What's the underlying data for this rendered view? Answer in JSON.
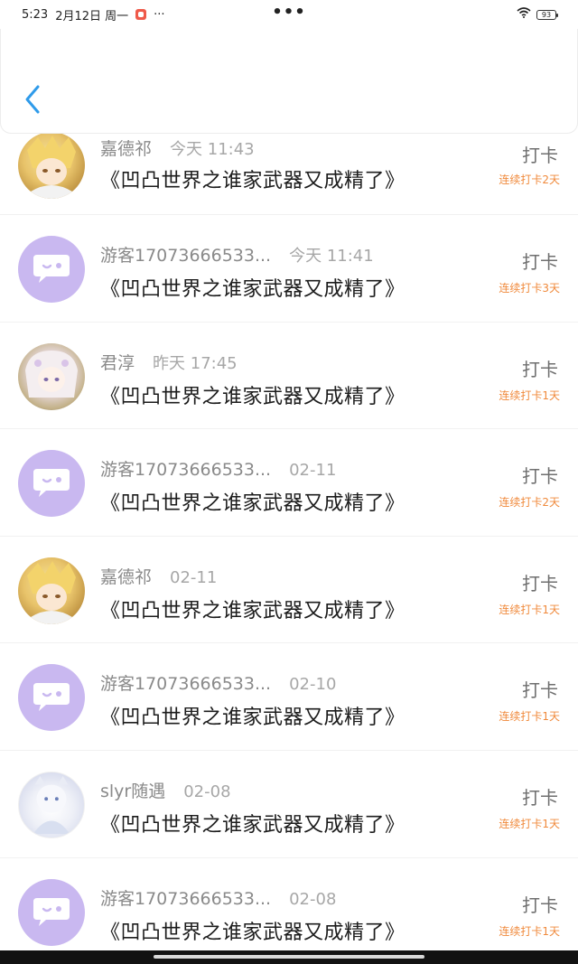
{
  "status_bar": {
    "time": "5:23",
    "date": "2月12日 周一",
    "more": "···",
    "center_dots": "•••",
    "battery": "93"
  },
  "header": {
    "back_icon": "chevron-left-icon",
    "accent_color": "#2f9bea"
  },
  "checkin_label": "打卡",
  "items": [
    {
      "name": "嘉德祁",
      "time": "今天 11:43",
      "title": "《凹凸世界之谁家武器又成精了》",
      "streak": "连续打卡2天",
      "avatar": "photo-a"
    },
    {
      "name": "游客17073666533...",
      "time": "今天 11:41",
      "title": "《凹凸世界之谁家武器又成精了》",
      "streak": "连续打卡3天",
      "avatar": "guest"
    },
    {
      "name": "君淳",
      "time": "昨天 17:45",
      "title": "《凹凸世界之谁家武器又成精了》",
      "streak": "连续打卡1天",
      "avatar": "photo-b"
    },
    {
      "name": "游客17073666533...",
      "time": "02-11",
      "title": "《凹凸世界之谁家武器又成精了》",
      "streak": "连续打卡2天",
      "avatar": "guest"
    },
    {
      "name": "嘉德祁",
      "time": "02-11",
      "title": "《凹凸世界之谁家武器又成精了》",
      "streak": "连续打卡1天",
      "avatar": "photo-a"
    },
    {
      "name": "游客17073666533...",
      "time": "02-10",
      "title": "《凹凸世界之谁家武器又成精了》",
      "streak": "连续打卡1天",
      "avatar": "guest"
    },
    {
      "name": "slyr随遇",
      "time": "02-08",
      "title": "《凹凸世界之谁家武器又成精了》",
      "streak": "连续打卡1天",
      "avatar": "photo-c"
    },
    {
      "name": "游客17073666533...",
      "time": "02-08",
      "title": "《凹凸世界之谁家武器又成精了》",
      "streak": "连续打卡1天",
      "avatar": "guest"
    }
  ],
  "colors": {
    "streak": "#f08a3c",
    "guest_avatar_bg": "#c9b8f0"
  }
}
